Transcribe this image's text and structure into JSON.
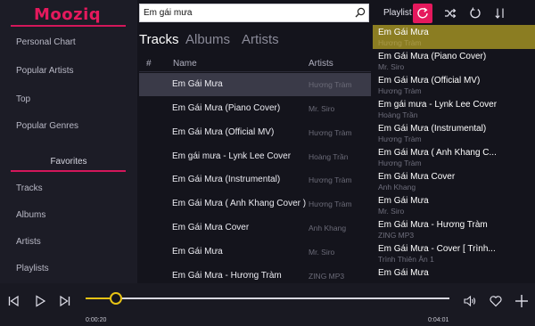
{
  "brand": {
    "logo_text": "Mooziq",
    "accent": "#e5195d"
  },
  "sidebar": {
    "items": [
      {
        "label": "Personal Chart"
      },
      {
        "label": "Popular Artists"
      },
      {
        "label": "Top"
      },
      {
        "label": "Popular Genres"
      }
    ],
    "favorites_title": "Favorites",
    "favorites": [
      {
        "label": "Tracks"
      },
      {
        "label": "Albums"
      },
      {
        "label": "Artists"
      },
      {
        "label": "Playlists"
      }
    ]
  },
  "search": {
    "value": "Em gái mưa",
    "icon": "search-icon"
  },
  "tabs": [
    {
      "label": "Tracks",
      "active": true
    },
    {
      "label": "Albums",
      "active": false
    },
    {
      "label": "Artists",
      "active": false
    }
  ],
  "table": {
    "headers": {
      "index": "#",
      "name": "Name",
      "artist": "Artists"
    },
    "rows": [
      {
        "title": "Em Gái Mưa",
        "artist": "Hương Tràm"
      },
      {
        "title": "Em Gái Mưa (Piano Cover)",
        "artist": "Mr. Siro"
      },
      {
        "title": "Em Gái Mưa (Official MV)",
        "artist": "Hương Tràm"
      },
      {
        "title": "Em gái mưa -  Lynk Lee Cover",
        "artist": "Hoàng Trần"
      },
      {
        "title": "Em Gái Mưa (Instrumental)",
        "artist": "Hương Tràm"
      },
      {
        "title": "Em Gái Mưa ( Anh Khang Cover )",
        "artist": "Hương Tràm"
      },
      {
        "title": "Em Gái Mưa Cover",
        "artist": "Anh Khang"
      },
      {
        "title": "Em Gái Mưa",
        "artist": "Mr. Siro"
      },
      {
        "title": "Em Gái Mưa  - Hương Tràm",
        "artist": "ZING MP3"
      }
    ],
    "selected_index": 0
  },
  "playlist": {
    "label": "Playlist",
    "items": [
      {
        "title": "Em Gái Mưa",
        "artist": "Hương Tràm"
      },
      {
        "title": "Em Gái Mưa (Piano Cover)",
        "artist": "Mr. Siro"
      },
      {
        "title": "Em Gái Mưa (Official MV)",
        "artist": "Hương Tràm"
      },
      {
        "title": "Em gái mưa -  Lynk Lee Cover",
        "artist": "Hoàng Trần"
      },
      {
        "title": "Em Gái Mưa (Instrumental)",
        "artist": "Hương Tràm"
      },
      {
        "title": "Em Gái Mưa ( Anh Khang C...",
        "artist": "Hương Tràm"
      },
      {
        "title": "Em Gái Mưa Cover",
        "artist": "Anh Khang"
      },
      {
        "title": "Em Gái Mưa",
        "artist": "Mr. Siro"
      },
      {
        "title": "Em Gái Mưa  - Hương Tràm",
        "artist": "ZING MP3"
      },
      {
        "title": "Em Gái Mưa  - Cover [ Trình...",
        "artist": "Trình Thiên Ân 1"
      },
      {
        "title": "Em Gái Mưa",
        "artist": ""
      }
    ],
    "selected_index": 0
  },
  "player": {
    "current_time": "0:00:20",
    "total_time": "0:04:01",
    "progress": 0.083
  }
}
